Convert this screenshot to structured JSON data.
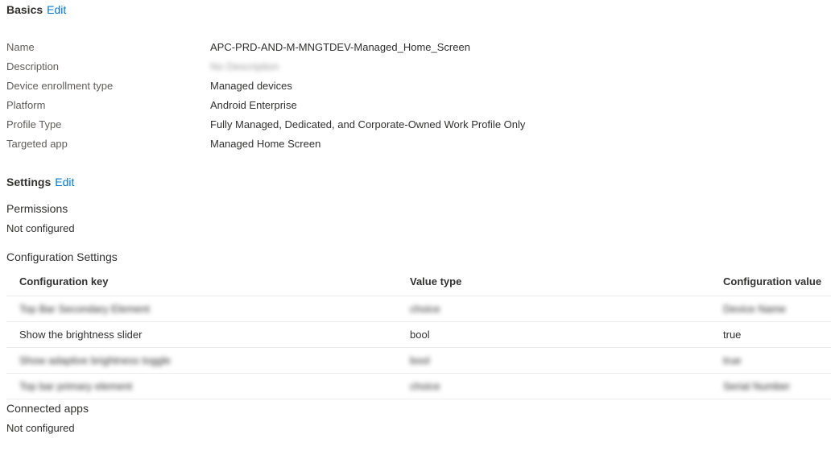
{
  "basics": {
    "title": "Basics",
    "edit_label": "Edit",
    "fields": [
      {
        "label": "Name",
        "value": "APC-PRD-AND-M-MNGTDEV-Managed_Home_Screen"
      },
      {
        "label": "Description",
        "value": "No Description"
      },
      {
        "label": "Device enrollment type",
        "value": "Managed devices"
      },
      {
        "label": "Platform",
        "value": "Android Enterprise"
      },
      {
        "label": "Profile Type",
        "value": "Fully Managed, Dedicated, and Corporate-Owned Work Profile Only"
      },
      {
        "label": "Targeted app",
        "value": "Managed Home Screen"
      }
    ]
  },
  "settings": {
    "title": "Settings",
    "edit_label": "Edit",
    "permissions_label": "Permissions",
    "permissions_value": "Not configured",
    "config_title": "Configuration Settings",
    "table": {
      "headers": [
        "Configuration key",
        "Value type",
        "Configuration value"
      ],
      "rows": [
        {
          "key": "Top Bar Secondary Element",
          "type": "choice",
          "value": "Device Name",
          "blurred": true
        },
        {
          "key": "Show the brightness slider",
          "type": "bool",
          "value": "true",
          "blurred": false
        },
        {
          "key": "Show adaptive brightness toggle",
          "type": "bool",
          "value": "true",
          "blurred": true
        },
        {
          "key": "Top bar primary element",
          "type": "choice",
          "value": "Serial Number",
          "blurred": true
        }
      ]
    },
    "connected_apps_label": "Connected apps",
    "connected_apps_value": "Not configured"
  }
}
